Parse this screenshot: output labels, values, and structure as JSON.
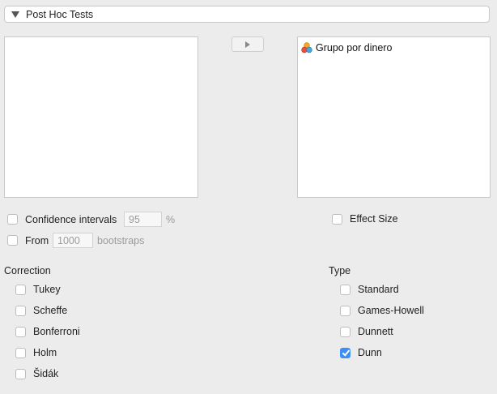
{
  "section": {
    "title": "Post Hoc Tests",
    "icon": "triangle-down-icon"
  },
  "variables": {
    "available": [],
    "selected": [
      {
        "label": "Grupo por dinero",
        "icon": "nominal-variable-icon"
      }
    ],
    "move_icon": "triangle-right-icon"
  },
  "options": {
    "confidence_intervals": {
      "label": "Confidence intervals",
      "value": "95",
      "unit": "%",
      "checked": false
    },
    "from": {
      "label": "From",
      "value": "1000",
      "unit": "bootstraps",
      "checked": false
    },
    "effect_size": {
      "label": "Effect Size",
      "checked": false
    }
  },
  "correction": {
    "title": "Correction",
    "items": [
      {
        "label": "Tukey",
        "checked": false
      },
      {
        "label": "Scheffe",
        "checked": false
      },
      {
        "label": "Bonferroni",
        "checked": false
      },
      {
        "label": "Holm",
        "checked": false
      },
      {
        "label": "Šidák",
        "checked": false
      }
    ]
  },
  "type": {
    "title": "Type",
    "items": [
      {
        "label": "Standard",
        "checked": false
      },
      {
        "label": "Games-Howell",
        "checked": false
      },
      {
        "label": "Dunnett",
        "checked": false
      },
      {
        "label": "Dunn",
        "checked": true
      }
    ]
  },
  "colors": {
    "accent": "#3d8ff5",
    "background": "#ececec"
  }
}
